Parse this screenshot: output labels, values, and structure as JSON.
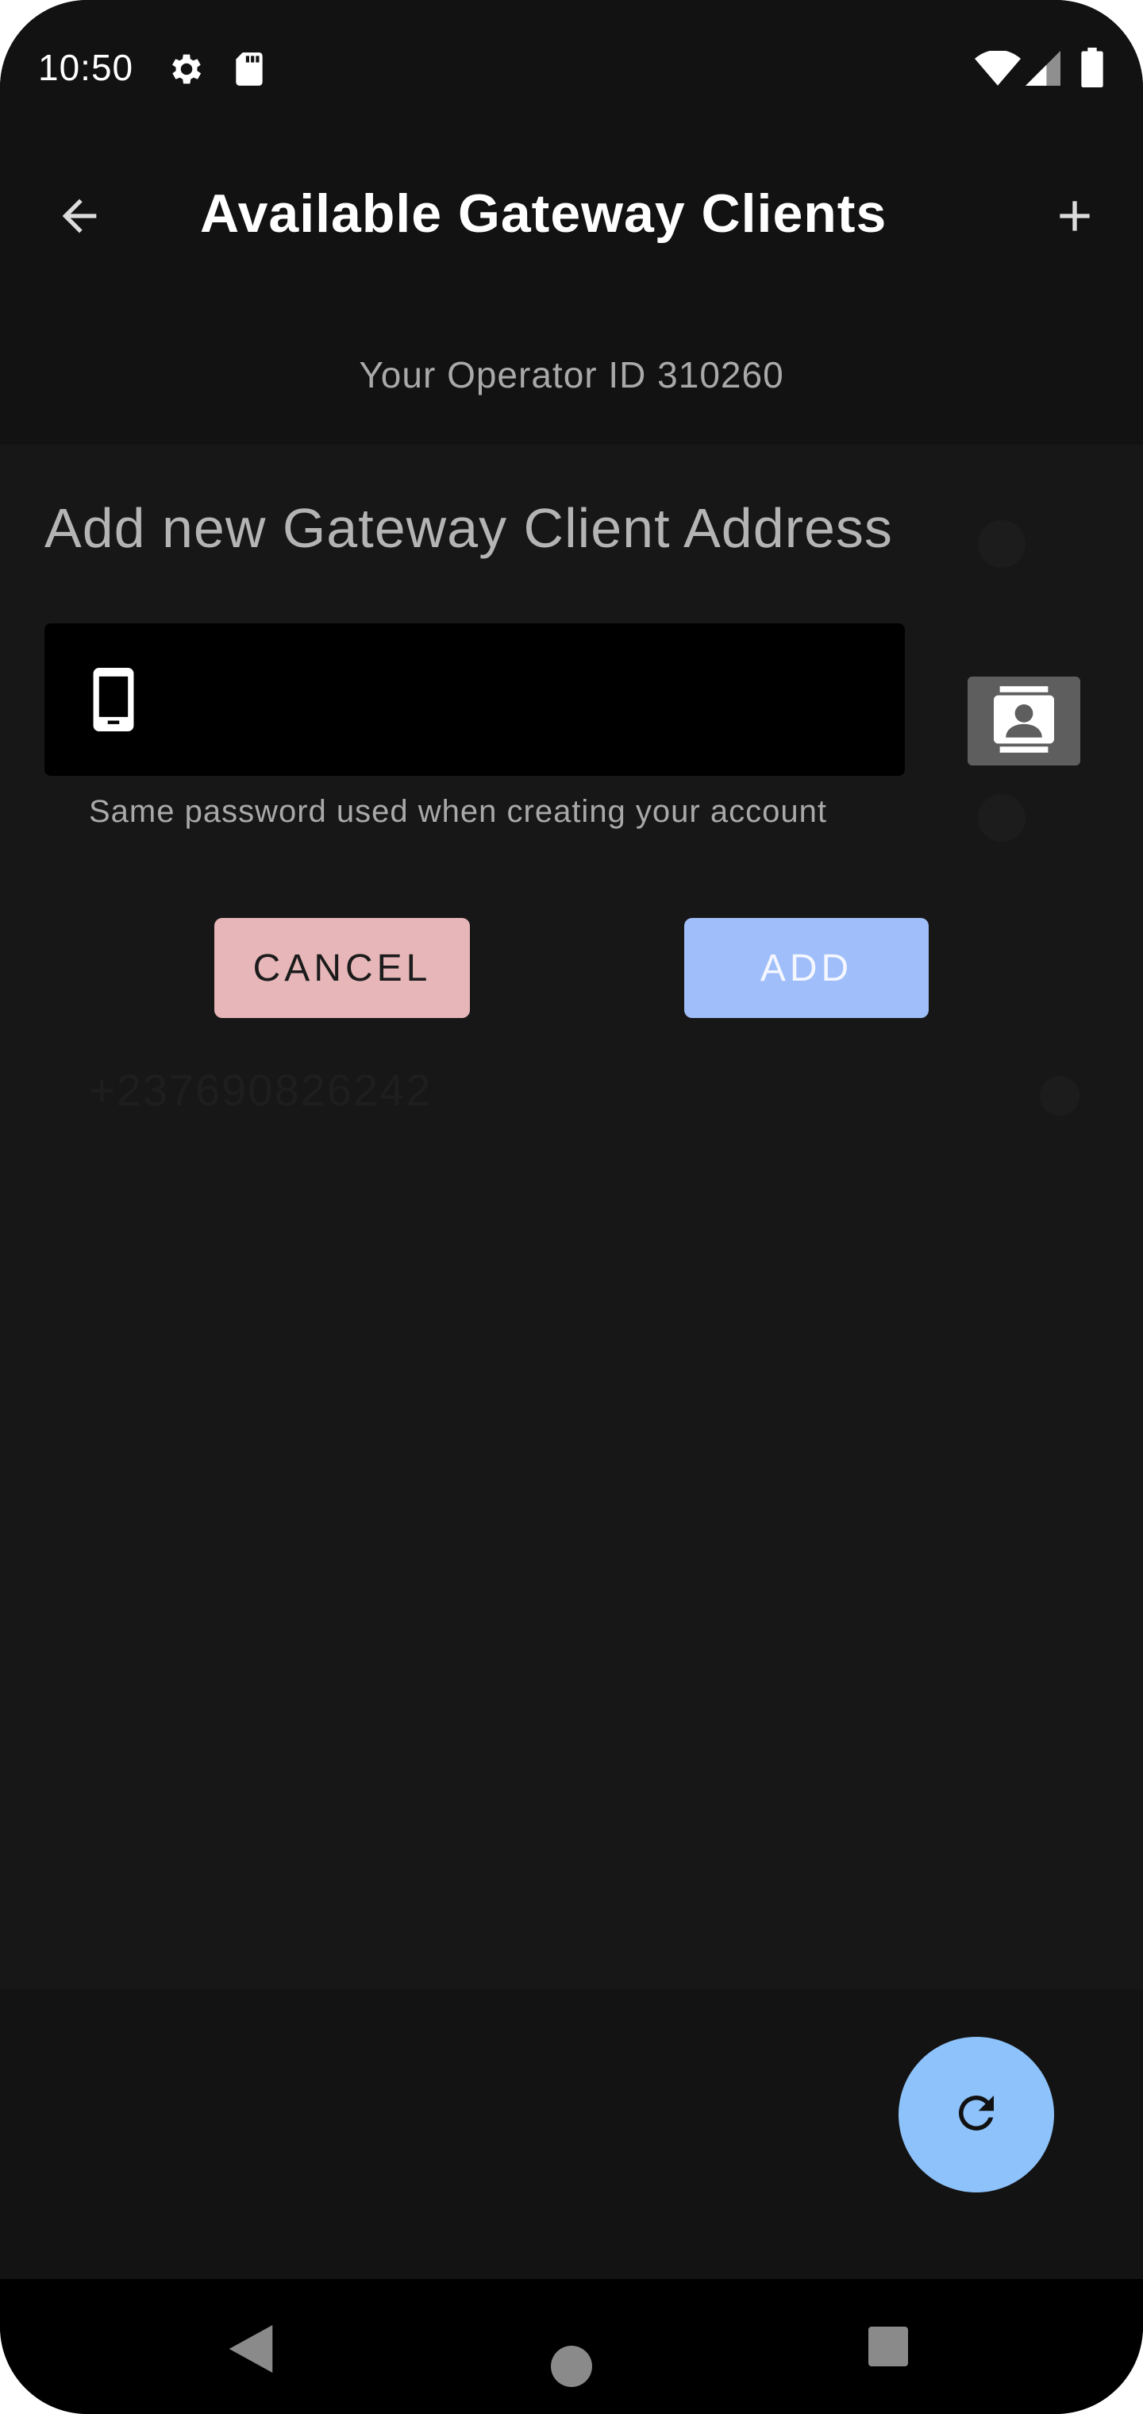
{
  "status_bar": {
    "time": "10:50",
    "icons": [
      "gear-icon",
      "sd-card-icon",
      "wifi-icon",
      "signal-icon",
      "battery-icon"
    ]
  },
  "app_bar": {
    "title": "Available Gateway Clients",
    "back_icon": "arrow-back-icon",
    "add_icon": "plus-icon"
  },
  "operator": {
    "text": "Your Operator ID 310260"
  },
  "dialog": {
    "title": "Add new Gateway Client Address",
    "input": {
      "value": "",
      "placeholder": "",
      "icon": "smartphone-icon"
    },
    "contacts_icon": "contacts-icon",
    "helper_text": "Same password used when creating your account",
    "cancel_label": "CANCEL",
    "add_label": "ADD"
  },
  "background_list": {
    "items": [
      "+237690826242"
    ]
  },
  "fab": {
    "icon": "refresh-icon"
  },
  "nav_bar": {
    "icons": [
      "nav-back-icon",
      "nav-home-icon",
      "nav-recents-icon"
    ]
  },
  "colors": {
    "background": "#171717",
    "cancel_button": "#e6b6b8",
    "add_button": "#a0befa",
    "fab": "#8ec2fb",
    "input_bg": "#000000"
  }
}
